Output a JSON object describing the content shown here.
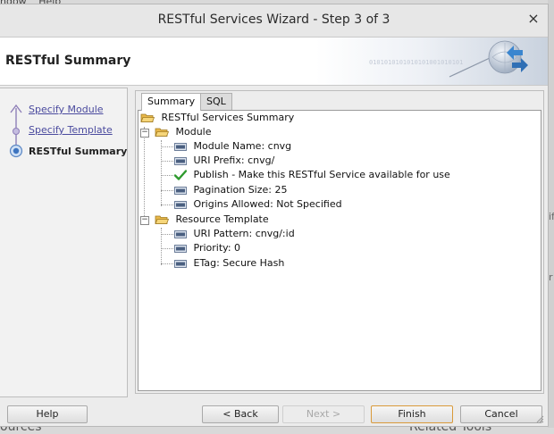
{
  "background": {
    "menu": [
      "ndow",
      "Help"
    ],
    "bottom_left": "ources",
    "bottom_right": "Related Tools",
    "right_edge": [
      "if",
      "r"
    ]
  },
  "window": {
    "title": "RESTful Services Wizard - Step 3 of 3",
    "close_glyph": "×"
  },
  "banner": {
    "title": "RESTful Summary",
    "decor_text": "0101010101010101001010101"
  },
  "steps": [
    {
      "label": "Specify Module",
      "state": "done"
    },
    {
      "label": "Specify Template",
      "state": "done"
    },
    {
      "label": "RESTful Summary",
      "state": "current"
    }
  ],
  "tabs": [
    {
      "label": "Summary",
      "active": true
    },
    {
      "label": "SQL",
      "active": false
    }
  ],
  "tree": {
    "root": {
      "label": "RESTful Services Summary",
      "icon": "folder-open-icon"
    },
    "module": {
      "label": "Module",
      "icon": "folder-open-icon",
      "expanded": true,
      "items": [
        {
          "label": "Module Name: cnvg",
          "icon": "property-icon"
        },
        {
          "label": "URI Prefix: cnvg/",
          "icon": "property-icon"
        },
        {
          "label": "Publish - Make this RESTful Service available for use",
          "icon": "checkmark-icon"
        },
        {
          "label": "Pagination Size: 25",
          "icon": "property-icon"
        },
        {
          "label": "Origins Allowed: Not Specified",
          "icon": "property-icon"
        }
      ]
    },
    "template": {
      "label": "Resource Template",
      "icon": "folder-open-icon",
      "expanded": true,
      "items": [
        {
          "label": "URI Pattern: cnvg/:id",
          "icon": "property-icon"
        },
        {
          "label": "Priority: 0",
          "icon": "property-icon"
        },
        {
          "label": "ETag: Secure Hash",
          "icon": "property-icon"
        }
      ]
    }
  },
  "buttons": {
    "help": "Help",
    "back": "< Back",
    "next": "Next >",
    "finish": "Finish",
    "cancel": "Cancel"
  },
  "colors": {
    "link": "#4a4a9e",
    "default_button_border": "#d99a3a",
    "checkmark": "#2e9a2e",
    "folder": "#e8b84a"
  }
}
